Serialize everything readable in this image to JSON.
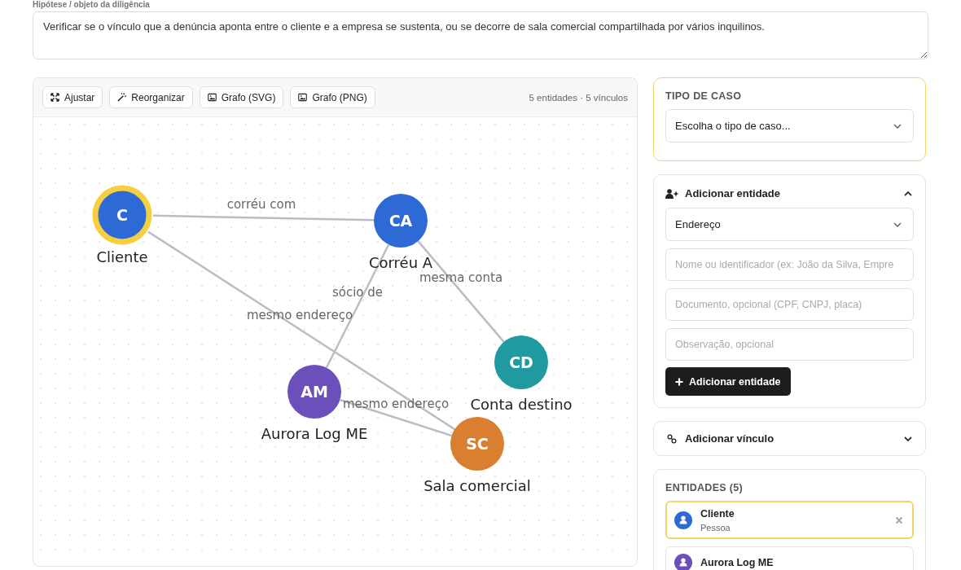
{
  "hypothesis": {
    "label": "Hipótese / objeto da diligência",
    "value": "Verificar se o vínculo que a denúncia aponta entre o cliente e a empresa se sustenta, ou se decorre de sala comercial compartilhada por vários inquilinos."
  },
  "toolbar": {
    "buttons": [
      {
        "label": "Ajustar",
        "kind": "fit"
      },
      {
        "label": "Reorganizar",
        "kind": "wand"
      },
      {
        "label": "Grafo (SVG)",
        "kind": "image"
      },
      {
        "label": "Grafo (PNG)",
        "kind": "image"
      }
    ],
    "summary": "5 entidades · 5 vínculos"
  },
  "graph": {
    "nodes": [
      {
        "initials": "C",
        "label": "Cliente",
        "color": "#2d6ad6",
        "selected": true
      },
      {
        "initials": "CA",
        "label": "Corréu A",
        "color": "#2d6ad6",
        "selected": false
      },
      {
        "initials": "CD",
        "label": "Conta destino",
        "color": "#1f9aa0",
        "selected": false
      },
      {
        "initials": "AM",
        "label": "Aurora Log ME",
        "color": "#6b4fbb",
        "selected": false
      },
      {
        "initials": "SC",
        "label": "Sala comercial",
        "color": "#d97f2f",
        "selected": false
      }
    ],
    "edges": [
      {
        "label": "corréu com"
      },
      {
        "label": "mesma conta"
      },
      {
        "label": "sócio de"
      },
      {
        "label": "mesmo endereço"
      },
      {
        "label": "mesmo endereço"
      }
    ]
  },
  "case_type": {
    "title": "TIPO DE CASO",
    "placeholder": "Escolha o tipo de caso..."
  },
  "add_entity": {
    "title": "Adicionar entidade",
    "expanded": true,
    "type_value": "Endereço",
    "fields": [
      {
        "placeholder": "Nome ou identificador (ex: João da Silva, Empre"
      },
      {
        "placeholder": "Documento, opcional (CPF, CNPJ, placa)"
      },
      {
        "placeholder": "Observação, opcional"
      }
    ],
    "button": "Adicionar entidade"
  },
  "add_link": {
    "title": "Adicionar vínculo",
    "expanded": false
  },
  "entities": {
    "title": "ENTIDADES (5)",
    "items": [
      {
        "name": "Cliente",
        "type": "Pessoa",
        "color": "#2d6ad6",
        "selected": true
      },
      {
        "name": "Aurora Log ME",
        "color": "#6b4fbb",
        "selected": false
      }
    ]
  }
}
